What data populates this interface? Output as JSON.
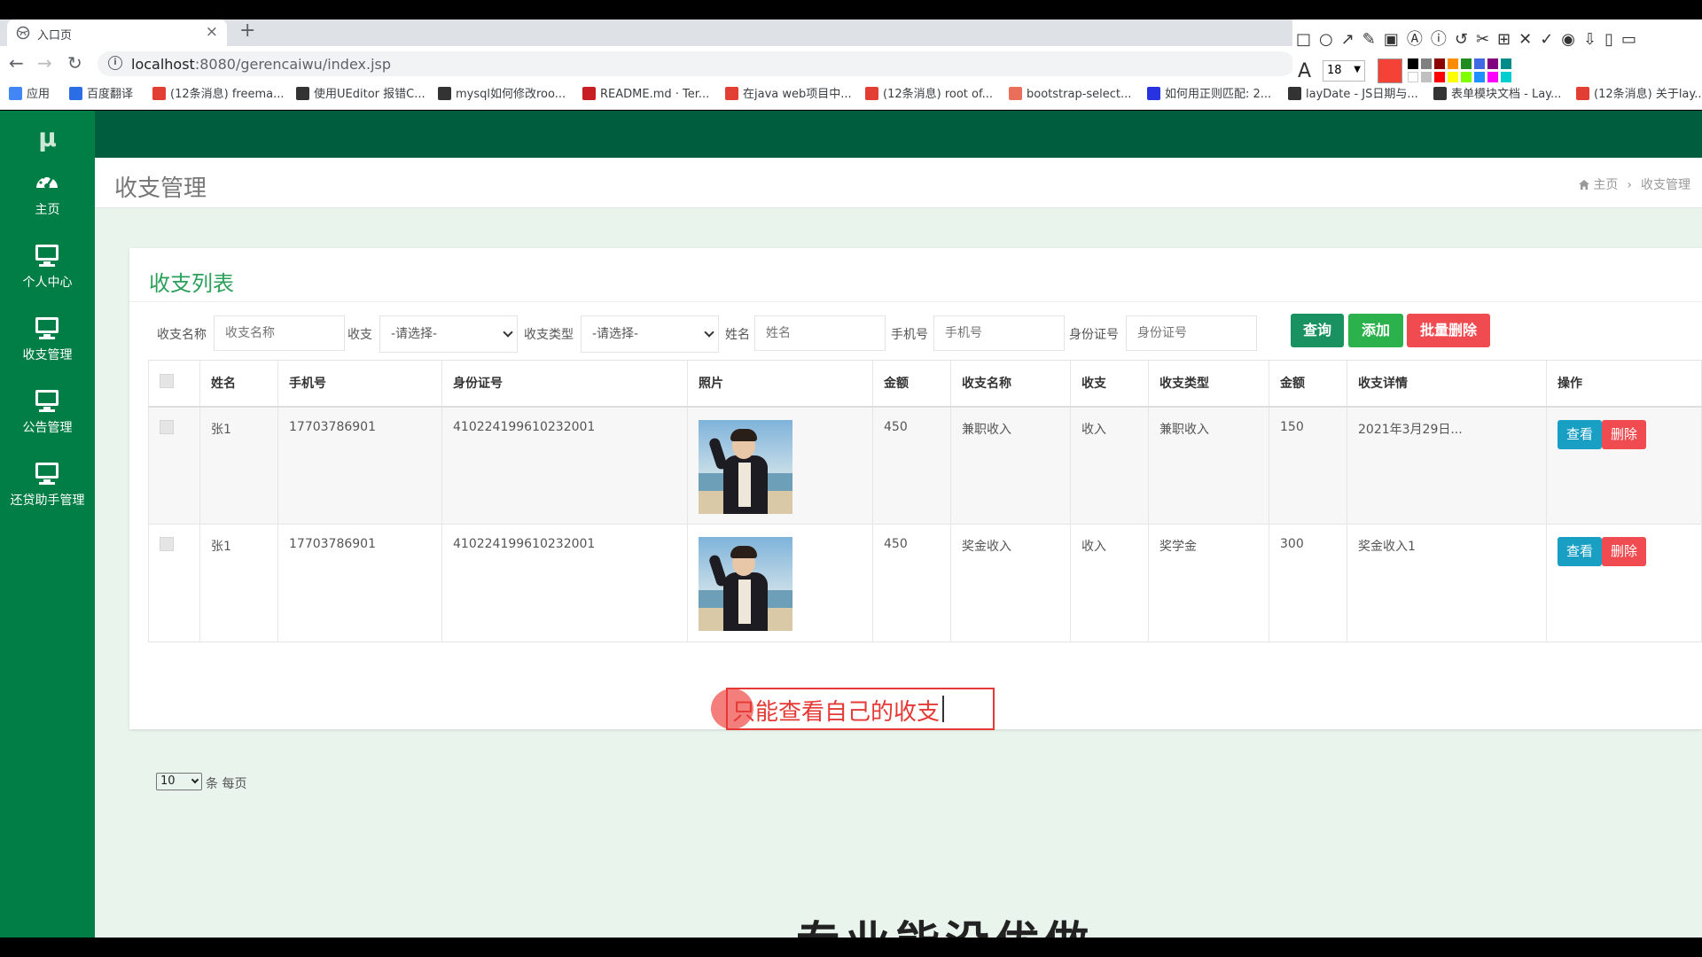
{
  "browser": {
    "tab_title": "入口页",
    "tab_close": "×",
    "new_tab": "+",
    "url_host": "localhost",
    "url_path": ":8080/gerencaiwu/index.jsp",
    "bookmarks": [
      {
        "label": "应用",
        "icon": "apps-icon",
        "color": "#4285f4"
      },
      {
        "label": "百度翻译",
        "icon": "translate-icon",
        "color": "#2b6de5"
      },
      {
        "label": "(12条消息) freema...",
        "icon": "csdn-icon",
        "color": "#e33e33"
      },
      {
        "label": "使用UEditor 报错C...",
        "icon": "link-icon",
        "color": "#333333"
      },
      {
        "label": "mysql如何修改roo...",
        "icon": "link-icon",
        "color": "#333333"
      },
      {
        "label": "README.md · Ter...",
        "icon": "gitee-icon",
        "color": "#c71d23"
      },
      {
        "label": "在java web项目中...",
        "icon": "csdn-icon",
        "color": "#e33e33"
      },
      {
        "label": "(12条消息) root of...",
        "icon": "csdn-icon",
        "color": "#e33e33"
      },
      {
        "label": "bootstrap-select...",
        "icon": "jianshu-icon",
        "color": "#ea6f5a"
      },
      {
        "label": "如何用正则匹配: 2...",
        "icon": "baidu-icon",
        "color": "#2932e1"
      },
      {
        "label": "layDate - JS日期与...",
        "icon": "layui-icon",
        "color": "#333333"
      },
      {
        "label": "表单模块文档 - Lay...",
        "icon": "layui-icon",
        "color": "#333333"
      },
      {
        "label": "(12条消息) 关于lay...",
        "icon": "csdn-icon",
        "color": "#e33e33"
      }
    ]
  },
  "drawtools": {
    "font_size": "18",
    "current_color": "#f44336",
    "palette": [
      "#000000",
      "#808080",
      "#8b0000",
      "#ff8c00",
      "#228b22",
      "#4169e1",
      "#800080",
      "#008b8b",
      "#ffffff",
      "#c0c0c0",
      "#ff0000",
      "#ffff00",
      "#7fff00",
      "#1e90ff",
      "#ff00ff",
      "#00ced1"
    ]
  },
  "sidebar": {
    "logo": "μ",
    "items": [
      {
        "label": "主页",
        "icon": "dashboard-icon"
      },
      {
        "label": "个人中心",
        "icon": "monitor-icon"
      },
      {
        "label": "收支管理",
        "icon": "monitor-icon"
      },
      {
        "label": "公告管理",
        "icon": "monitor-icon"
      },
      {
        "label": "还贷助手管理",
        "icon": "monitor-icon"
      }
    ]
  },
  "header": {
    "title": "收支管理",
    "breadcrumb_home": "主页",
    "breadcrumb_sep": "›",
    "breadcrumb_current": "收支管理"
  },
  "panel": {
    "title": "收支列表",
    "filters": {
      "name_label": "收支名称",
      "name_placeholder": "收支名称",
      "type_label": "收支",
      "type_value": "-请选择-",
      "category_label": "收支类型",
      "category_value": "-请选择-",
      "person_label": "姓名",
      "person_placeholder": "姓名",
      "phone_label": "手机号",
      "phone_placeholder": "手机号",
      "id_label": "身份证号",
      "id_placeholder": "身份证号"
    },
    "buttons": {
      "query": "查询",
      "add": "添加",
      "batch_delete": "批量删除",
      "query_color": "#1a9160",
      "add_color": "#2bb24c",
      "delete_color": "#f04b51"
    },
    "columns": [
      "姓名",
      "手机号",
      "身份证号",
      "照片",
      "金额",
      "收支名称",
      "收支",
      "收支类型",
      "金额",
      "收支详情",
      "操作"
    ],
    "rows": [
      {
        "name": "张1",
        "phone": "17703786901",
        "id_no": "410224199610232001",
        "amount": "450",
        "item_name": "兼职收入",
        "direction": "收入",
        "category": "兼职收入",
        "amount2": "150",
        "detail": "2021年3月29日..."
      },
      {
        "name": "张1",
        "phone": "17703786901",
        "id_no": "410224199610232001",
        "amount": "450",
        "item_name": "奖金收入",
        "direction": "收入",
        "category": "奖学金",
        "amount2": "300",
        "detail": "奖金收入1"
      }
    ],
    "row_actions": {
      "view": "查看",
      "delete": "删除",
      "view_color": "#1a9fc4",
      "delete_color": "#f04b51"
    },
    "page_size": "10",
    "page_size_label": "条 每页"
  },
  "annotation": {
    "text": "只能查看自己的收支"
  },
  "subtitle_peek": "专业能没优做"
}
